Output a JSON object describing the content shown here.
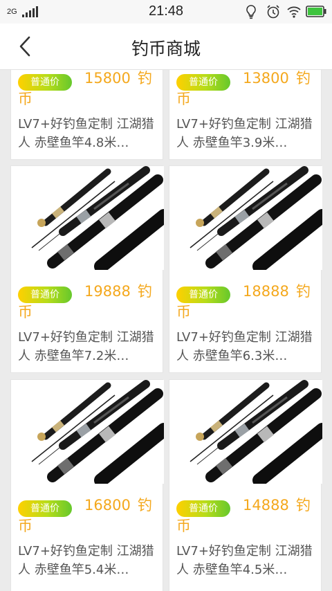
{
  "status_bar": {
    "network": "2G",
    "time": "21:48"
  },
  "header": {
    "title": "钓币商城"
  },
  "products": [
    {
      "badge": "普通价",
      "price": "15800",
      "unit": "钓",
      "unit2": "币",
      "name": "LV7+好钓鱼定制 江湖猎人 赤壁鱼竿4.8米…"
    },
    {
      "badge": "普通价",
      "price": "13800",
      "unit": "钓",
      "unit2": "币",
      "name": "LV7+好钓鱼定制 江湖猎人 赤壁鱼竿3.9米…"
    },
    {
      "badge": "普通价",
      "price": "19888",
      "unit": "钓",
      "unit2": "币",
      "name": "LV7+好钓鱼定制 江湖猎人 赤壁鱼竿7.2米…"
    },
    {
      "badge": "普通价",
      "price": "18888",
      "unit": "钓",
      "unit2": "币",
      "name": "LV7+好钓鱼定制 江湖猎人 赤壁鱼竿6.3米…"
    },
    {
      "badge": "普通价",
      "price": "16800",
      "unit": "钓",
      "unit2": "币",
      "name": "LV7+好钓鱼定制 江湖猎人 赤壁鱼竿5.4米…"
    },
    {
      "badge": "普通价",
      "price": "14888",
      "unit": "钓",
      "unit2": "币",
      "name": "LV7+好钓鱼定制 江湖猎人 赤壁鱼竿4.5米…"
    }
  ],
  "colors": {
    "price": "#f4a81d",
    "badge_from": "#ffd000",
    "badge_to": "#66c82c"
  }
}
